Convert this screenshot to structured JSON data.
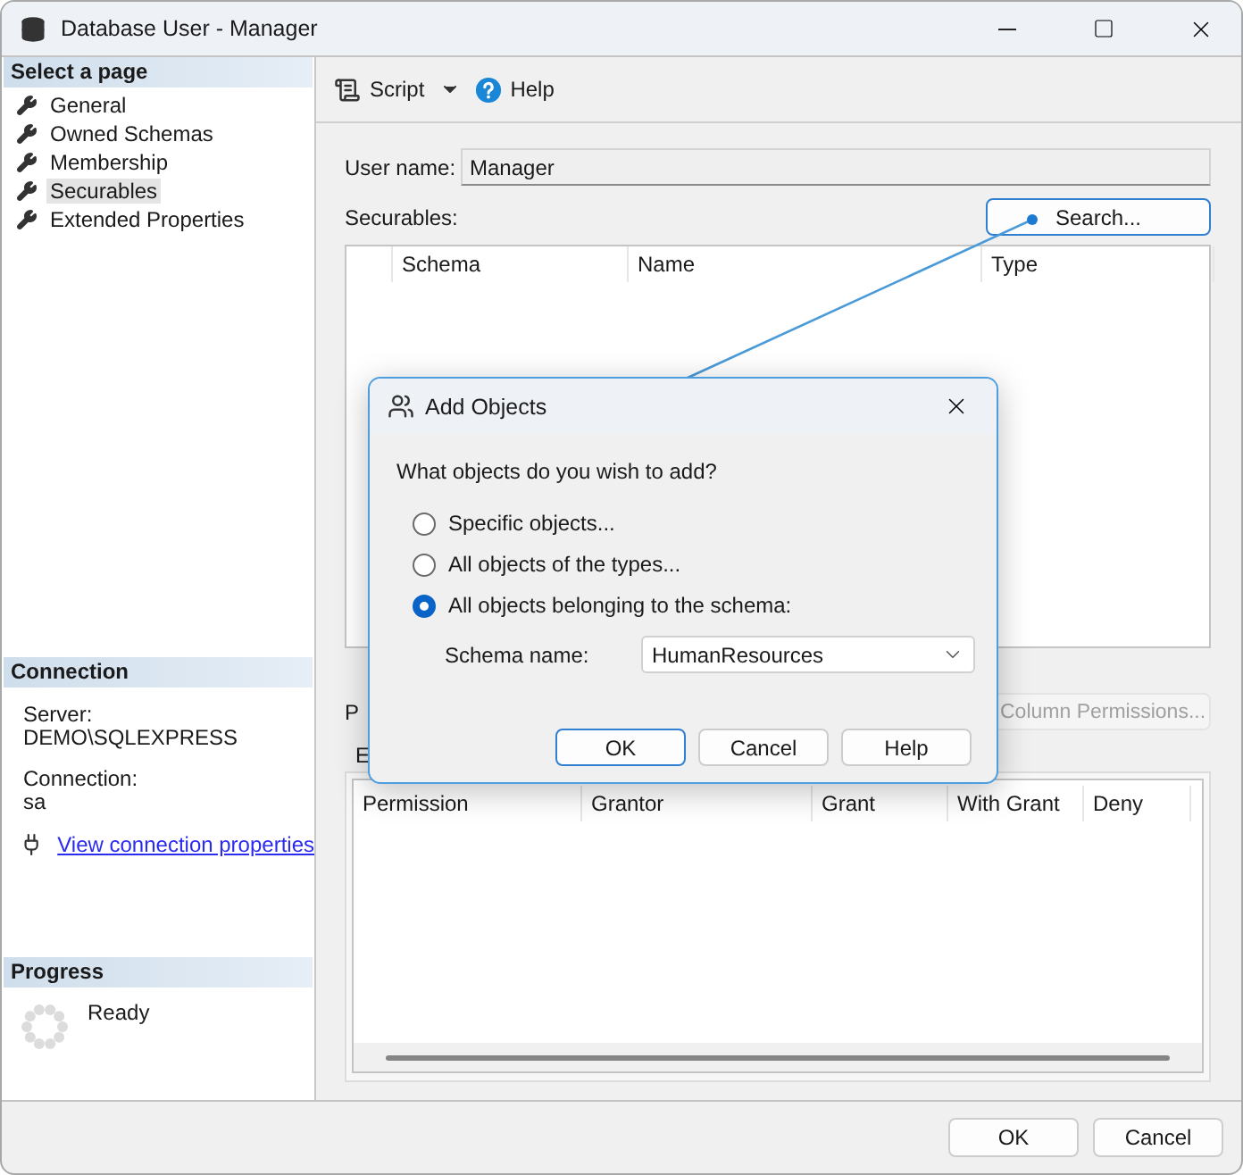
{
  "window": {
    "title": "Database User - Manager"
  },
  "sidebar": {
    "header": "Select a page",
    "items": [
      {
        "label": "General",
        "selected": false
      },
      {
        "label": "Owned Schemas",
        "selected": false
      },
      {
        "label": "Membership",
        "selected": false
      },
      {
        "label": "Securables",
        "selected": true
      },
      {
        "label": "Extended Properties",
        "selected": false
      }
    ]
  },
  "connection": {
    "header": "Connection",
    "server_label": "Server:",
    "server": "DEMO\\SQLEXPRESS",
    "connection_label": "Connection:",
    "connection": "sa",
    "link": "View connection properties"
  },
  "progress": {
    "header": "Progress",
    "status": "Ready"
  },
  "toolbar": {
    "script": "Script",
    "help": "Help"
  },
  "user_name": {
    "label": "User name:",
    "value": "Manager"
  },
  "securables": {
    "label": "Securables:",
    "search_button": "Search...",
    "columns": [
      "Schema",
      "Name",
      "Type"
    ]
  },
  "permissions": {
    "label": "P",
    "column_permissions_button": {
      "label": "Column Permissions...",
      "disabled": true
    },
    "tab": "E",
    "columns": [
      "Permission",
      "Grantor",
      "Grant",
      "With Grant",
      "Deny"
    ]
  },
  "buttons": [
    "OK",
    "Cancel"
  ],
  "dialog": {
    "title": "Add Objects",
    "question": "What objects do you wish to add?",
    "options": [
      {
        "label": "Specific objects...",
        "selected": false
      },
      {
        "label": "All objects of the types...",
        "selected": false
      },
      {
        "label": "All objects belonging to the schema:",
        "selected": true
      }
    ],
    "schema_label": "Schema name:",
    "schema_value": "HumanResources",
    "buttons": [
      "OK",
      "Cancel",
      "Help"
    ]
  }
}
